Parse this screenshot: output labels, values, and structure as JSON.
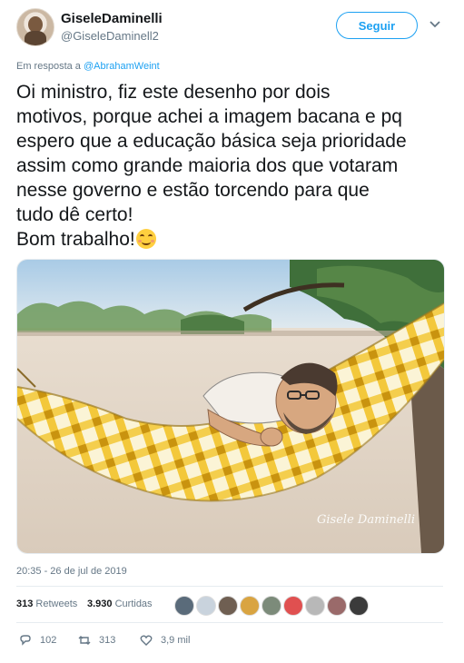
{
  "user": {
    "display_name": "GiseleDaminelli",
    "handle": "@GiseleDaminell2",
    "follow_label": "Seguir"
  },
  "reply": {
    "prefix": "Em resposta a ",
    "mention": "@AbrahamWeint"
  },
  "tweet": {
    "text": "Oi ministro, fiz este desenho por dois\nmotivos, porque achei a imagem bacana e pq\nespero que a educação básica seja prioridade\nassim como grande maioria dos que votaram\nnesse governo e estão torcendo para que\ntudo dê certo!\nBom trabalho!",
    "emoji": "smiling-face-icon",
    "timestamp": "20:35 - 26 de jul de 2019"
  },
  "media": {
    "signature": "Gisele Daminelli"
  },
  "stats": {
    "retweets_count": "313",
    "retweets_label": "Retweets",
    "likes_count": "3.930",
    "likes_label": "Curtidas"
  },
  "liker_colors": [
    "#5a6b7a",
    "#c9d3dd",
    "#6f5f52",
    "#d9a441",
    "#7c8b7a",
    "#e05050",
    "#b8b8b8",
    "#9a6a6a",
    "#3b3b3b"
  ],
  "actions": {
    "replies": "102",
    "retweets": "313",
    "likes": "3,9 mil"
  },
  "colors": {
    "accent": "#1da1f2",
    "muted": "#657786",
    "hammock_yellow": "#f2c42a"
  }
}
